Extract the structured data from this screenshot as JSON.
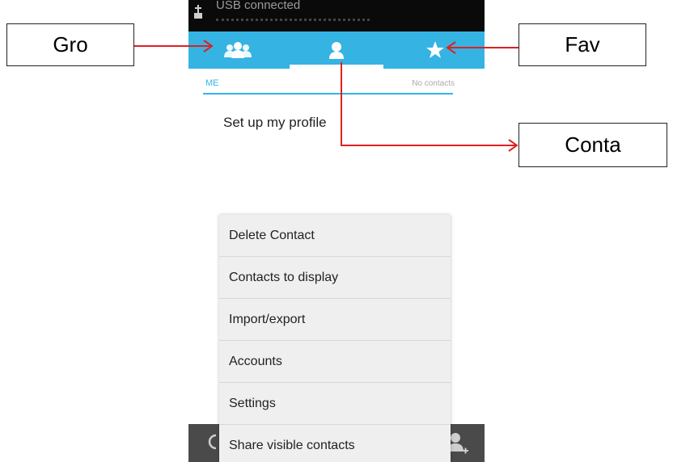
{
  "status_bar": {
    "text": "USB connected"
  },
  "tabs": [
    {
      "name": "groups",
      "icon": "groups-icon"
    },
    {
      "name": "contacts",
      "icon": "person-icon",
      "selected": true
    },
    {
      "name": "favorites",
      "icon": "star-icon"
    }
  ],
  "me_section": {
    "label": "ME",
    "count_text": "No contacts"
  },
  "profile": {
    "setup_text": "Set up my profile"
  },
  "menu": {
    "items": [
      "Delete Contact",
      "Contacts to display",
      "Import/export",
      "Accounts",
      "Settings",
      "Share visible contacts"
    ]
  },
  "callouts": {
    "left": "Gro",
    "right_top": "Fav",
    "right_mid": "Conta"
  },
  "colors": {
    "accent": "#35b3e3",
    "arrow": "#e02020",
    "menu_bg": "#efefef",
    "status_bar": "#0a0a0a",
    "bottom_bar": "#4a4a4a"
  }
}
